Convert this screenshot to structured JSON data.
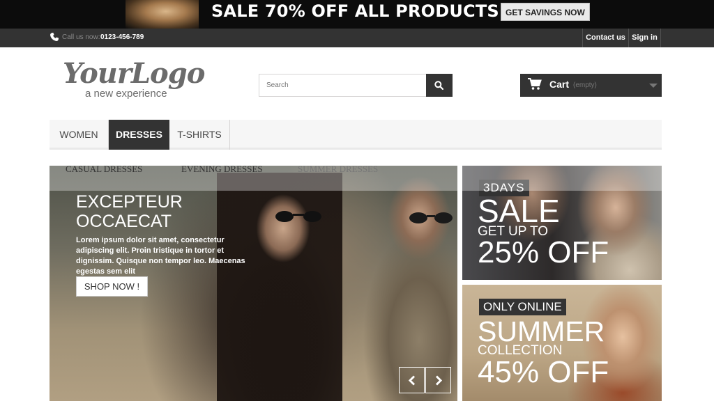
{
  "promo": {
    "text": "SALE 70% OFF ALL PRODUCTS",
    "button": "GET SAVINGS NOW"
  },
  "topbar": {
    "call_label": "Call us now:",
    "call_number": "0123-456-789",
    "contact": "Contact us",
    "signin": "Sign in"
  },
  "logo": {
    "main": "YourLogo",
    "tagline": "a new experience"
  },
  "search": {
    "placeholder": "Search"
  },
  "cart": {
    "label": "Cart",
    "status": "(empty)"
  },
  "menu": {
    "items": [
      "WOMEN",
      "DRESSES",
      "T-SHIRTS"
    ],
    "active": "DRESSES"
  },
  "submenu": {
    "items": [
      "CASUAL DRESSES",
      "EVENING DRESSES",
      "SUMMER DRESSES"
    ]
  },
  "slide": {
    "title_line1": "EXCEPTEUR",
    "title_line2": "OCCAECAT",
    "description": "Lorem ipsum dolor sit amet, consectetur adipiscing elit. Proin tristique in tortor et dignissim. Quisque non tempor leo. Maecenas egestas sem elit",
    "button": "SHOP NOW !"
  },
  "banner1": {
    "tag": "3DAYS",
    "headline": "SALE",
    "subline": "GET UP TO",
    "offer": "25% OFF"
  },
  "banner2": {
    "tag": "ONLY ONLINE",
    "headline": "SUMMER",
    "subline": "COLLECTION",
    "offer": "45% OFF"
  },
  "colors": {
    "dark": "#333333",
    "menu_bg": "#f6f6f6",
    "border": "#d6d4d4"
  }
}
